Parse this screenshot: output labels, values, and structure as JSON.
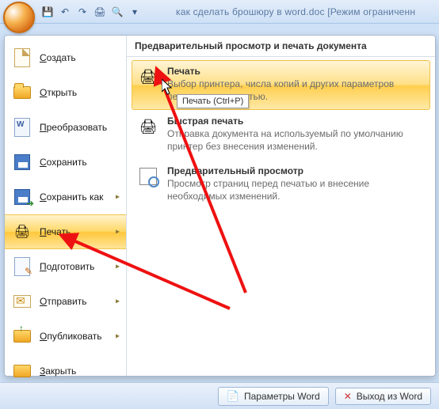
{
  "titlebar": {
    "doc_title": "как сделать брошюру в word.doc [Режим ограниченн"
  },
  "qat": {
    "save": "save",
    "undo": "undo",
    "redo": "redo",
    "quickprint": "quickprint",
    "preview": "preview"
  },
  "left_menu": {
    "items": [
      {
        "label": "Создать"
      },
      {
        "label": "Открыть"
      },
      {
        "label": "Преобразовать"
      },
      {
        "label": "Сохранить"
      },
      {
        "label": "Сохранить как"
      },
      {
        "label": "Печать"
      },
      {
        "label": "Подготовить"
      },
      {
        "label": "Отправить"
      },
      {
        "label": "Опубликовать"
      },
      {
        "label": "Закрыть"
      }
    ]
  },
  "right_panel": {
    "heading": "Предварительный просмотр и печать документа",
    "items": [
      {
        "title": "Печать",
        "desc": "Выбор принтера, числа копий и других параметров печати перед печатью."
      },
      {
        "title": "Быстрая печать",
        "desc": "Отправка документа на используемый по умолчанию принтер без внесения изменений."
      },
      {
        "title": "Предварительный просмотр",
        "desc": "Просмотр страниц перед печатью и внесение необходимых изменений."
      }
    ],
    "tooltip": "Печать (Ctrl+P)"
  },
  "footer": {
    "options_label": "Параметры Word",
    "exit_label": "Выход из Word"
  }
}
